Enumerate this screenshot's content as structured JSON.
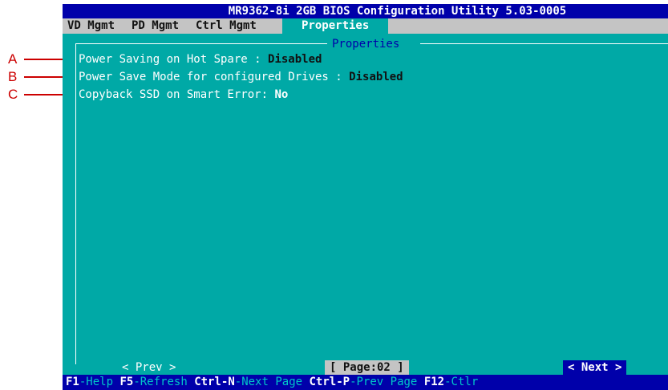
{
  "callouts": [
    "A",
    "B",
    "C"
  ],
  "titlebar": "MR9362-8i 2GB BIOS Configuration Utility 5.03-0005",
  "menu": [
    {
      "label": "VD Mgmt",
      "active": false
    },
    {
      "label": "PD Mgmt",
      "active": false
    },
    {
      "label": "Ctrl Mgmt",
      "active": false
    },
    {
      "label": "Properties",
      "active": true
    }
  ],
  "panel_title": "Properties",
  "properties": [
    {
      "label": "Power Saving on Hot Spare :",
      "value": "Disabled"
    },
    {
      "label": "Power Save Mode for configured Drives :",
      "value": "Disabled"
    },
    {
      "label": "Copyback SSD on Smart Error:",
      "value": "No"
    }
  ],
  "nav": {
    "prev": "< Prev >",
    "page": "[ Page:02 ]",
    "next": "< Next >"
  },
  "fkeys": [
    {
      "key": "F1",
      "desc": "-Help"
    },
    {
      "key": "F5",
      "desc": "-Refresh"
    },
    {
      "key": "Ctrl-N",
      "desc": "-Next Page"
    },
    {
      "key": "Ctrl-P",
      "desc": "-Prev Page"
    },
    {
      "key": "F12",
      "desc": "-Ctlr"
    }
  ],
  "colors": {
    "screen_bg": "#00a9a6",
    "title_bg": "#0000aa",
    "menu_bg": "#c4c4c4",
    "callout": "#cc0000"
  }
}
